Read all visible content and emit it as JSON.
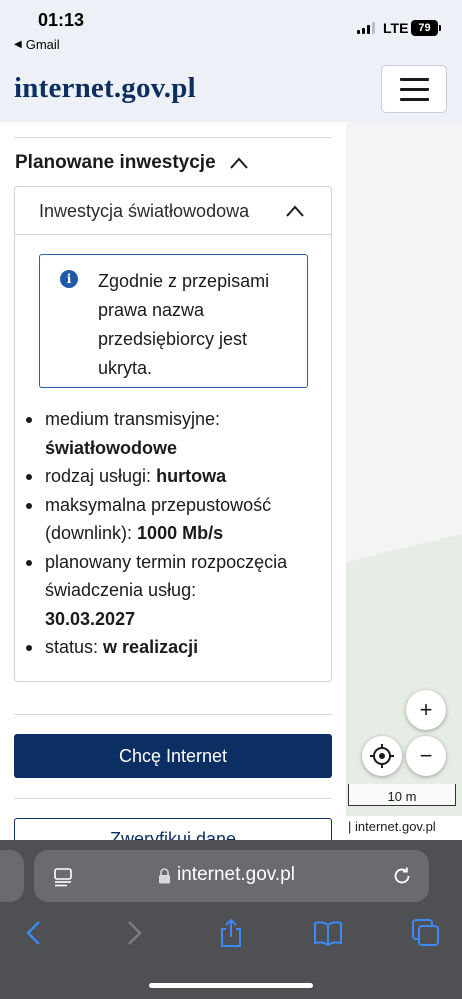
{
  "status_bar": {
    "time": "01:13",
    "back_app": "Gmail",
    "network": "LTE",
    "battery": "79"
  },
  "header": {
    "logo": "internet.gov.pl",
    "menu_icon": "hamburger-icon"
  },
  "panel": {
    "section_title": "Planowane inwestycje",
    "card": {
      "title": "Inwestycja światłowodowa",
      "info_text": "Zgodnie z przepisami prawa nazwa przedsiębiorcy jest ukryta.",
      "details": [
        {
          "label": "medium transmisyjne:",
          "value": "światłowodowe"
        },
        {
          "label": "rodzaj usługi:",
          "value": "hurtowa"
        },
        {
          "label": "maksymalna przepustowość (downlink):",
          "value": "1000 Mb/s"
        },
        {
          "label": "planowany termin rozpoczęcia świadczenia usług:",
          "value": "30.03.2027"
        },
        {
          "label": "status:",
          "value": "w realizacji"
        }
      ]
    },
    "cta_label": "Chcę Internet",
    "verify_label": "Zweryfikuj dane"
  },
  "map": {
    "zoom_in": "+",
    "zoom_out": "−",
    "scale_label": "10 m",
    "attribution": "| internet.gov.pl"
  },
  "browser": {
    "url": "internet.gov.pl",
    "toolbar_icons": [
      "back-icon",
      "forward-icon",
      "share-icon",
      "bookmarks-icon",
      "tabs-icon"
    ]
  },
  "colors": {
    "brand_navy": "#0c2f63",
    "info_blue": "#1f5aa6",
    "header_bg": "#edf1f7",
    "toolbar_bg": "#4f5054",
    "ios_blue": "#3b8af5"
  }
}
